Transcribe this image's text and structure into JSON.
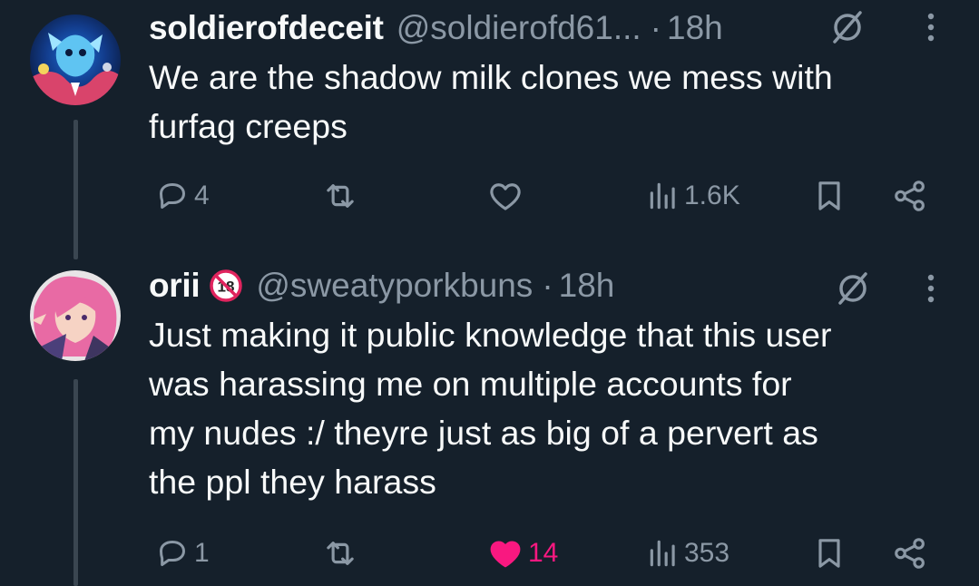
{
  "tweets": [
    {
      "display_name": "soldierofdeceit",
      "handle": "@soldierofd61...",
      "separator": "·",
      "time": "18h",
      "text": "We are the shadow milk clones we mess with\nfurfag creeps",
      "replies": "4",
      "reposts": "",
      "likes": "",
      "views": "1.6K",
      "liked": false
    },
    {
      "display_name": "orii",
      "badge": "18",
      "handle": "@sweatyporkbuns",
      "separator": "·",
      "time": "18h",
      "text": "Just making it public knowledge that this user\nwas harassing me on multiple accounts for\nmy nudes :/ theyre just as big of a pervert as\nthe ppl they harass",
      "replies": "1",
      "reposts": "",
      "likes": "14",
      "views": "353",
      "liked": true
    }
  ],
  "colors": {
    "background": "#15202b",
    "text": "#f7f9f9",
    "secondary": "#8b98a5",
    "like": "#f91880",
    "thread_line": "#3a4651"
  },
  "icons": [
    "reply-icon",
    "repost-icon",
    "like-icon",
    "views-icon",
    "bookmark-icon",
    "share-icon",
    "grok-icon",
    "more-icon"
  ]
}
